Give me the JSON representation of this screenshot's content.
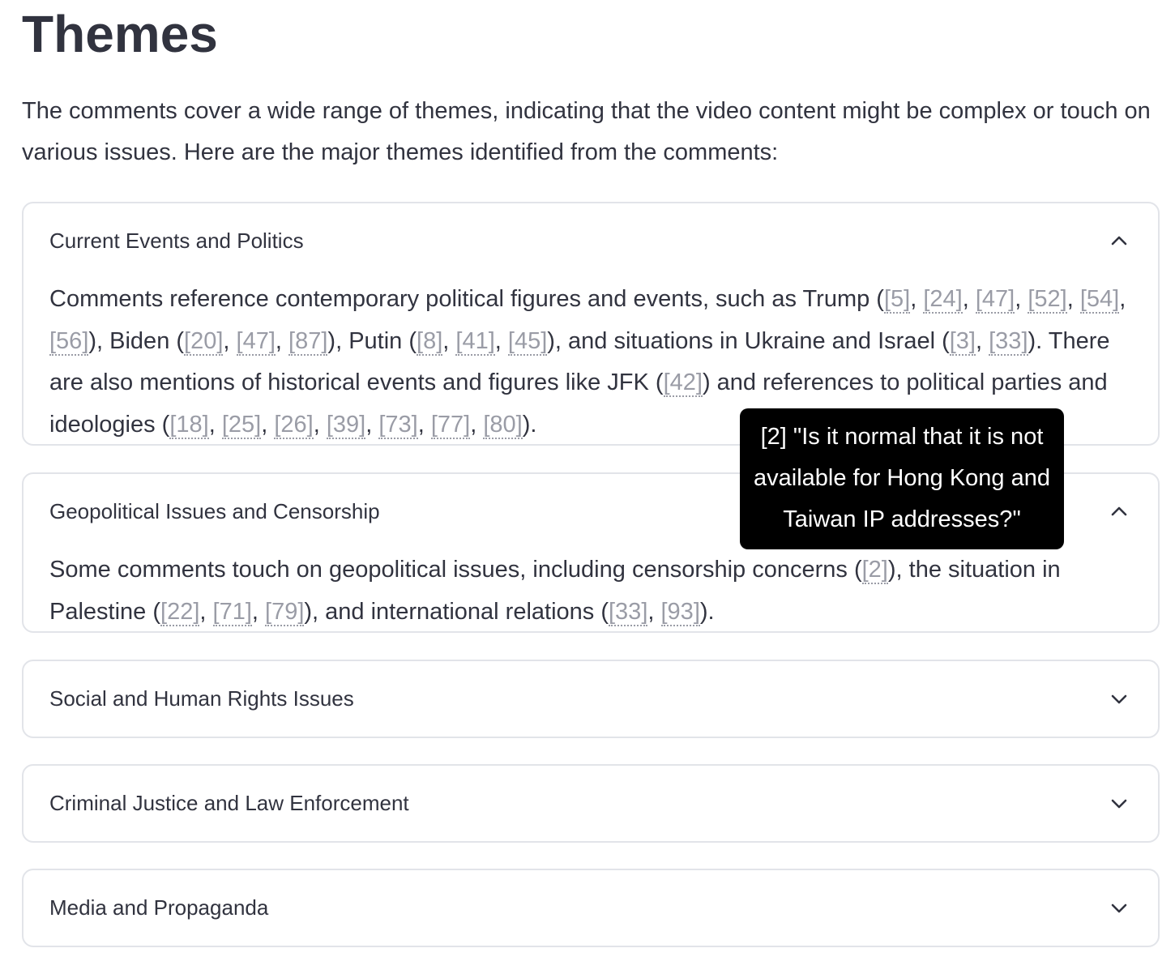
{
  "header": {
    "title": "Themes",
    "intro": "The comments cover a wide range of themes, indicating that the video content might be complex or touch on various issues. Here are the major themes identified from the comments:"
  },
  "expanders": [
    {
      "title": "Current Events and Politics",
      "state": "expanded",
      "icon": "chevron-up-icon",
      "body": [
        {
          "t": "Comments reference contemporary political figures and events, such as Trump ("
        },
        {
          "c": "[5]"
        },
        {
          "t": ", "
        },
        {
          "c": "[24]"
        },
        {
          "t": ", "
        },
        {
          "c": "[47]"
        },
        {
          "t": ", "
        },
        {
          "c": "[52]"
        },
        {
          "t": ", "
        },
        {
          "c": "[54]"
        },
        {
          "t": ", "
        },
        {
          "c": "[56]"
        },
        {
          "t": "), Biden ("
        },
        {
          "c": "[20]"
        },
        {
          "t": ", "
        },
        {
          "c": "[47]"
        },
        {
          "t": ", "
        },
        {
          "c": "[87]"
        },
        {
          "t": "), Putin ("
        },
        {
          "c": "[8]"
        },
        {
          "t": ", "
        },
        {
          "c": "[41]"
        },
        {
          "t": ", "
        },
        {
          "c": "[45]"
        },
        {
          "t": "), and situations in Ukraine and Israel ("
        },
        {
          "c": "[3]"
        },
        {
          "t": ", "
        },
        {
          "c": "[33]"
        },
        {
          "t": "). There are also mentions of historical events and figures like JFK ("
        },
        {
          "c": "[42]"
        },
        {
          "t": ") and references to political parties and ideologies ("
        },
        {
          "c": "[18]"
        },
        {
          "t": ", "
        },
        {
          "c": "[25]"
        },
        {
          "t": ", "
        },
        {
          "c": "[26]"
        },
        {
          "t": ", "
        },
        {
          "c": "[39]"
        },
        {
          "t": ", "
        },
        {
          "c": "[73]"
        },
        {
          "t": ", "
        },
        {
          "c": "[77]"
        },
        {
          "t": ", "
        },
        {
          "c": "[80]"
        },
        {
          "t": ")."
        }
      ]
    },
    {
      "title": "Geopolitical Issues and Censorship",
      "state": "expanded",
      "icon": "chevron-up-icon",
      "body": [
        {
          "t": "Some comments touch on geopolitical issues, including censorship concerns ("
        },
        {
          "c": "[2]"
        },
        {
          "t": "), the situation in Palestine ("
        },
        {
          "c": "[22]"
        },
        {
          "t": ", "
        },
        {
          "c": "[71]"
        },
        {
          "t": ", "
        },
        {
          "c": "[79]"
        },
        {
          "t": "), and international relations ("
        },
        {
          "c": "[33]"
        },
        {
          "t": ", "
        },
        {
          "c": "[93]"
        },
        {
          "t": ")."
        }
      ]
    },
    {
      "title": "Social and Human Rights Issues",
      "state": "collapsed",
      "icon": "chevron-down-icon"
    },
    {
      "title": "Criminal Justice and Law Enforcement",
      "state": "collapsed",
      "icon": "chevron-down-icon"
    },
    {
      "title": "Media and Propaganda",
      "state": "collapsed",
      "icon": "chevron-down-icon"
    }
  ],
  "tooltip": {
    "text": "[2] \"Is it normal that it is not available for Hong Kong and Taiwan IP addresses?\""
  },
  "colors": {
    "text": "#31333f",
    "citation": "#9a9ca6",
    "border": "#e2e4e9",
    "tooltip_bg": "#000000"
  }
}
